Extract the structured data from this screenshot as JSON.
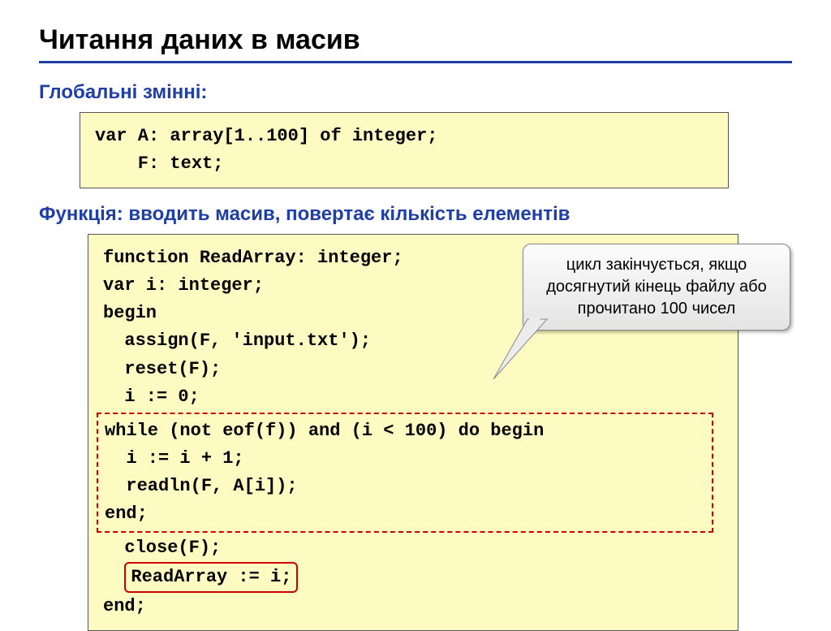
{
  "title": "Читання даних в масив",
  "section1": "Глобальні змінні:",
  "code1_l1": "var A: array[1..100] of integer;",
  "code1_l2": "    F: text;",
  "section2": "Функція: вводить масив, повертає кількість елементів",
  "fn_l1": "function ReadArray: integer;",
  "fn_l2": "var i: integer;",
  "fn_l3": "begin",
  "fn_l4": "  assign(F, 'input.txt');",
  "fn_l5": "  reset(F);",
  "fn_l6": "  i := 0;",
  "loop_l1": "while (not eof(f)) and (i < 100) do begin",
  "loop_l2": "  i := i + 1;",
  "loop_l3": "  readln(F, A[i]);",
  "loop_l4": "end;",
  "fn_l7": "  close(F);",
  "ret": "ReadArray := i;",
  "fn_l8": "end;",
  "callout": "цикл закінчується, якщо досягнутий кінець файлу або прочитано 100 чисел"
}
